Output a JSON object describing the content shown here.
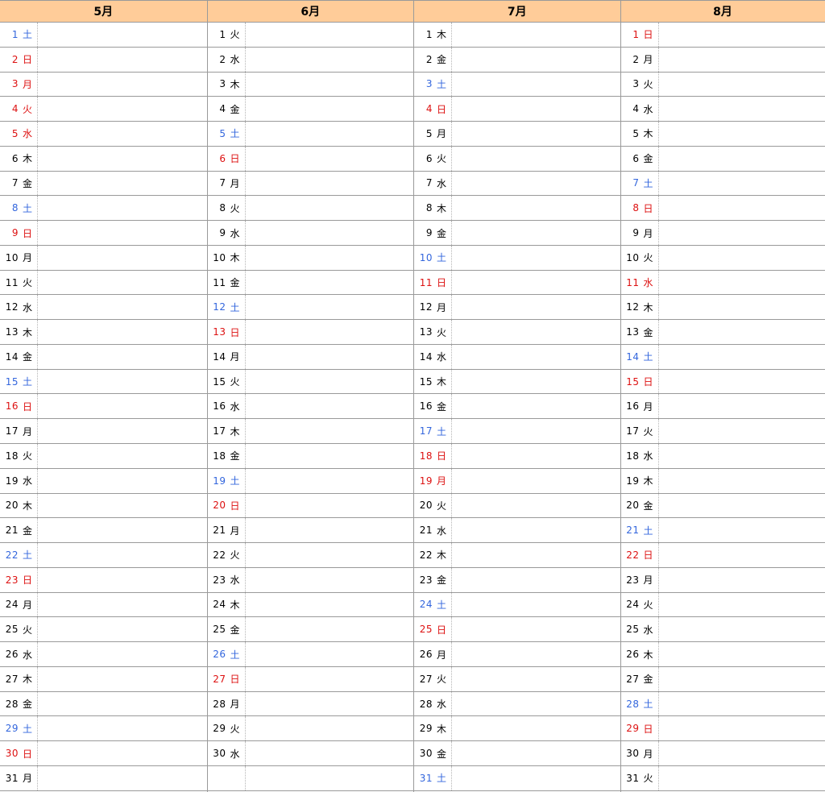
{
  "months": [
    {
      "title": "5月",
      "days": [
        {
          "n": "1",
          "w": "土",
          "t": "sat"
        },
        {
          "n": "2",
          "w": "日",
          "t": "hol"
        },
        {
          "n": "3",
          "w": "月",
          "t": "hol"
        },
        {
          "n": "4",
          "w": "火",
          "t": "hol"
        },
        {
          "n": "5",
          "w": "水",
          "t": "hol"
        },
        {
          "n": "6",
          "w": "木",
          "t": ""
        },
        {
          "n": "7",
          "w": "金",
          "t": ""
        },
        {
          "n": "8",
          "w": "土",
          "t": "sat"
        },
        {
          "n": "9",
          "w": "日",
          "t": "hol"
        },
        {
          "n": "10",
          "w": "月",
          "t": ""
        },
        {
          "n": "11",
          "w": "火",
          "t": ""
        },
        {
          "n": "12",
          "w": "水",
          "t": ""
        },
        {
          "n": "13",
          "w": "木",
          "t": ""
        },
        {
          "n": "14",
          "w": "金",
          "t": ""
        },
        {
          "n": "15",
          "w": "土",
          "t": "sat"
        },
        {
          "n": "16",
          "w": "日",
          "t": "hol"
        },
        {
          "n": "17",
          "w": "月",
          "t": ""
        },
        {
          "n": "18",
          "w": "火",
          "t": ""
        },
        {
          "n": "19",
          "w": "水",
          "t": ""
        },
        {
          "n": "20",
          "w": "木",
          "t": ""
        },
        {
          "n": "21",
          "w": "金",
          "t": ""
        },
        {
          "n": "22",
          "w": "土",
          "t": "sat"
        },
        {
          "n": "23",
          "w": "日",
          "t": "hol"
        },
        {
          "n": "24",
          "w": "月",
          "t": ""
        },
        {
          "n": "25",
          "w": "火",
          "t": ""
        },
        {
          "n": "26",
          "w": "水",
          "t": ""
        },
        {
          "n": "27",
          "w": "木",
          "t": ""
        },
        {
          "n": "28",
          "w": "金",
          "t": ""
        },
        {
          "n": "29",
          "w": "土",
          "t": "sat"
        },
        {
          "n": "30",
          "w": "日",
          "t": "hol"
        },
        {
          "n": "31",
          "w": "月",
          "t": ""
        }
      ]
    },
    {
      "title": "6月",
      "days": [
        {
          "n": "1",
          "w": "火",
          "t": ""
        },
        {
          "n": "2",
          "w": "水",
          "t": ""
        },
        {
          "n": "3",
          "w": "木",
          "t": ""
        },
        {
          "n": "4",
          "w": "金",
          "t": ""
        },
        {
          "n": "5",
          "w": "土",
          "t": "sat"
        },
        {
          "n": "6",
          "w": "日",
          "t": "hol"
        },
        {
          "n": "7",
          "w": "月",
          "t": ""
        },
        {
          "n": "8",
          "w": "火",
          "t": ""
        },
        {
          "n": "9",
          "w": "水",
          "t": ""
        },
        {
          "n": "10",
          "w": "木",
          "t": ""
        },
        {
          "n": "11",
          "w": "金",
          "t": ""
        },
        {
          "n": "12",
          "w": "土",
          "t": "sat"
        },
        {
          "n": "13",
          "w": "日",
          "t": "hol"
        },
        {
          "n": "14",
          "w": "月",
          "t": ""
        },
        {
          "n": "15",
          "w": "火",
          "t": ""
        },
        {
          "n": "16",
          "w": "水",
          "t": ""
        },
        {
          "n": "17",
          "w": "木",
          "t": ""
        },
        {
          "n": "18",
          "w": "金",
          "t": ""
        },
        {
          "n": "19",
          "w": "土",
          "t": "sat"
        },
        {
          "n": "20",
          "w": "日",
          "t": "hol"
        },
        {
          "n": "21",
          "w": "月",
          "t": ""
        },
        {
          "n": "22",
          "w": "火",
          "t": ""
        },
        {
          "n": "23",
          "w": "水",
          "t": ""
        },
        {
          "n": "24",
          "w": "木",
          "t": ""
        },
        {
          "n": "25",
          "w": "金",
          "t": ""
        },
        {
          "n": "26",
          "w": "土",
          "t": "sat"
        },
        {
          "n": "27",
          "w": "日",
          "t": "hol"
        },
        {
          "n": "28",
          "w": "月",
          "t": ""
        },
        {
          "n": "29",
          "w": "火",
          "t": ""
        },
        {
          "n": "30",
          "w": "水",
          "t": ""
        }
      ]
    },
    {
      "title": "7月",
      "days": [
        {
          "n": "1",
          "w": "木",
          "t": ""
        },
        {
          "n": "2",
          "w": "金",
          "t": ""
        },
        {
          "n": "3",
          "w": "土",
          "t": "sat"
        },
        {
          "n": "4",
          "w": "日",
          "t": "hol"
        },
        {
          "n": "5",
          "w": "月",
          "t": ""
        },
        {
          "n": "6",
          "w": "火",
          "t": ""
        },
        {
          "n": "7",
          "w": "水",
          "t": ""
        },
        {
          "n": "8",
          "w": "木",
          "t": ""
        },
        {
          "n": "9",
          "w": "金",
          "t": ""
        },
        {
          "n": "10",
          "w": "土",
          "t": "sat"
        },
        {
          "n": "11",
          "w": "日",
          "t": "hol"
        },
        {
          "n": "12",
          "w": "月",
          "t": ""
        },
        {
          "n": "13",
          "w": "火",
          "t": ""
        },
        {
          "n": "14",
          "w": "水",
          "t": ""
        },
        {
          "n": "15",
          "w": "木",
          "t": ""
        },
        {
          "n": "16",
          "w": "金",
          "t": ""
        },
        {
          "n": "17",
          "w": "土",
          "t": "sat"
        },
        {
          "n": "18",
          "w": "日",
          "t": "hol"
        },
        {
          "n": "19",
          "w": "月",
          "t": "hol"
        },
        {
          "n": "20",
          "w": "火",
          "t": ""
        },
        {
          "n": "21",
          "w": "水",
          "t": ""
        },
        {
          "n": "22",
          "w": "木",
          "t": ""
        },
        {
          "n": "23",
          "w": "金",
          "t": ""
        },
        {
          "n": "24",
          "w": "土",
          "t": "sat"
        },
        {
          "n": "25",
          "w": "日",
          "t": "hol"
        },
        {
          "n": "26",
          "w": "月",
          "t": ""
        },
        {
          "n": "27",
          "w": "火",
          "t": ""
        },
        {
          "n": "28",
          "w": "水",
          "t": ""
        },
        {
          "n": "29",
          "w": "木",
          "t": ""
        },
        {
          "n": "30",
          "w": "金",
          "t": ""
        },
        {
          "n": "31",
          "w": "土",
          "t": "sat"
        }
      ]
    },
    {
      "title": "8月",
      "days": [
        {
          "n": "1",
          "w": "日",
          "t": "hol"
        },
        {
          "n": "2",
          "w": "月",
          "t": ""
        },
        {
          "n": "3",
          "w": "火",
          "t": ""
        },
        {
          "n": "4",
          "w": "水",
          "t": ""
        },
        {
          "n": "5",
          "w": "木",
          "t": ""
        },
        {
          "n": "6",
          "w": "金",
          "t": ""
        },
        {
          "n": "7",
          "w": "土",
          "t": "sat"
        },
        {
          "n": "8",
          "w": "日",
          "t": "hol"
        },
        {
          "n": "9",
          "w": "月",
          "t": ""
        },
        {
          "n": "10",
          "w": "火",
          "t": ""
        },
        {
          "n": "11",
          "w": "水",
          "t": "hol"
        },
        {
          "n": "12",
          "w": "木",
          "t": ""
        },
        {
          "n": "13",
          "w": "金",
          "t": ""
        },
        {
          "n": "14",
          "w": "土",
          "t": "sat"
        },
        {
          "n": "15",
          "w": "日",
          "t": "hol"
        },
        {
          "n": "16",
          "w": "月",
          "t": ""
        },
        {
          "n": "17",
          "w": "火",
          "t": ""
        },
        {
          "n": "18",
          "w": "水",
          "t": ""
        },
        {
          "n": "19",
          "w": "木",
          "t": ""
        },
        {
          "n": "20",
          "w": "金",
          "t": ""
        },
        {
          "n": "21",
          "w": "土",
          "t": "sat"
        },
        {
          "n": "22",
          "w": "日",
          "t": "hol"
        },
        {
          "n": "23",
          "w": "月",
          "t": ""
        },
        {
          "n": "24",
          "w": "火",
          "t": ""
        },
        {
          "n": "25",
          "w": "水",
          "t": ""
        },
        {
          "n": "26",
          "w": "木",
          "t": ""
        },
        {
          "n": "27",
          "w": "金",
          "t": ""
        },
        {
          "n": "28",
          "w": "土",
          "t": "sat"
        },
        {
          "n": "29",
          "w": "日",
          "t": "hol"
        },
        {
          "n": "30",
          "w": "月",
          "t": ""
        },
        {
          "n": "31",
          "w": "火",
          "t": ""
        }
      ]
    }
  ],
  "colors": {
    "header_bg": "#ffcc99",
    "saturday": "#3366dd",
    "holiday": "#dd1111",
    "weekday": "#000000",
    "grid": "#9a9a9a"
  }
}
